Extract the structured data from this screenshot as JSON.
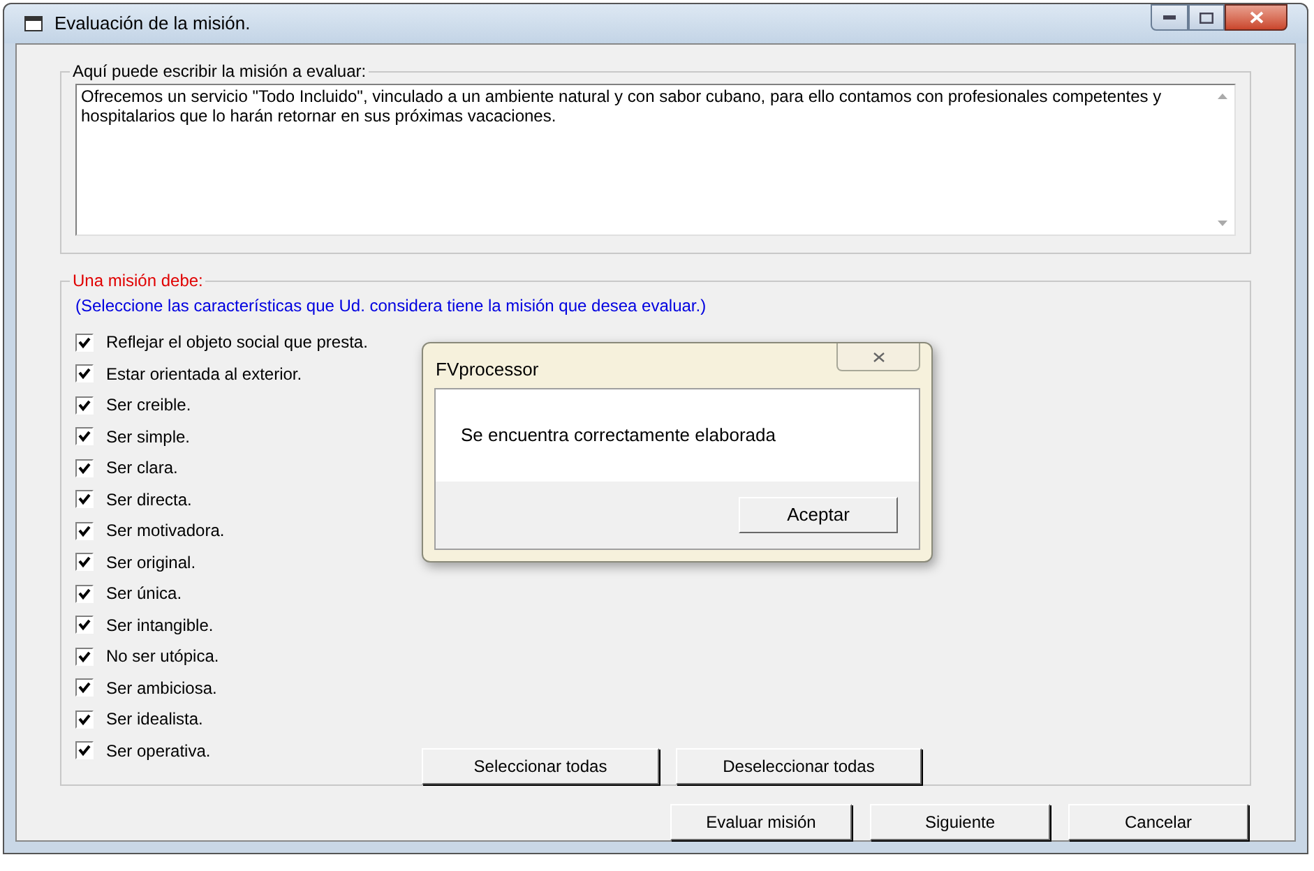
{
  "window": {
    "title": "Evaluación de la misión."
  },
  "mission_group": {
    "label": "Aquí puede escribir  la misión a evaluar:",
    "text": "Ofrecemos un servicio \"Todo Incluido\", vinculado a un ambiente natural y con sabor cubano, para ello contamos con profesionales competentes y hospitalarios que lo harán retornar en sus próximas vacaciones."
  },
  "criteria_group": {
    "label": "Una misión debe:",
    "hint": "(Seleccione las características que Ud. considera tiene la misión que desea evaluar.)",
    "items": [
      {
        "label": "Reflejar el objeto social que presta.",
        "checked": true
      },
      {
        "label": "Estar orientada al exterior.",
        "checked": true
      },
      {
        "label": "Ser creible.",
        "checked": true
      },
      {
        "label": "Ser simple.",
        "checked": true
      },
      {
        "label": "Ser clara.",
        "checked": true
      },
      {
        "label": "Ser directa.",
        "checked": true
      },
      {
        "label": "Ser motivadora.",
        "checked": true
      },
      {
        "label": "Ser original.",
        "checked": true
      },
      {
        "label": "Ser única.",
        "checked": true
      },
      {
        "label": "Ser intangible.",
        "checked": true
      },
      {
        "label": "No ser utópica.",
        "checked": true
      },
      {
        "label": "Ser ambiciosa.",
        "checked": true
      },
      {
        "label": "Ser idealista.",
        "checked": true
      },
      {
        "label": "Ser operativa.",
        "checked": true
      }
    ],
    "buttons": [
      "Seleccionar todas",
      "Deseleccionar todas"
    ]
  },
  "buttons": [
    "Evaluar misión",
    "Siguiente",
    "Cancelar"
  ],
  "message_box": {
    "title": "FVprocessor",
    "message": "Se encuentra correctamente elaborada",
    "button": "Aceptar"
  }
}
